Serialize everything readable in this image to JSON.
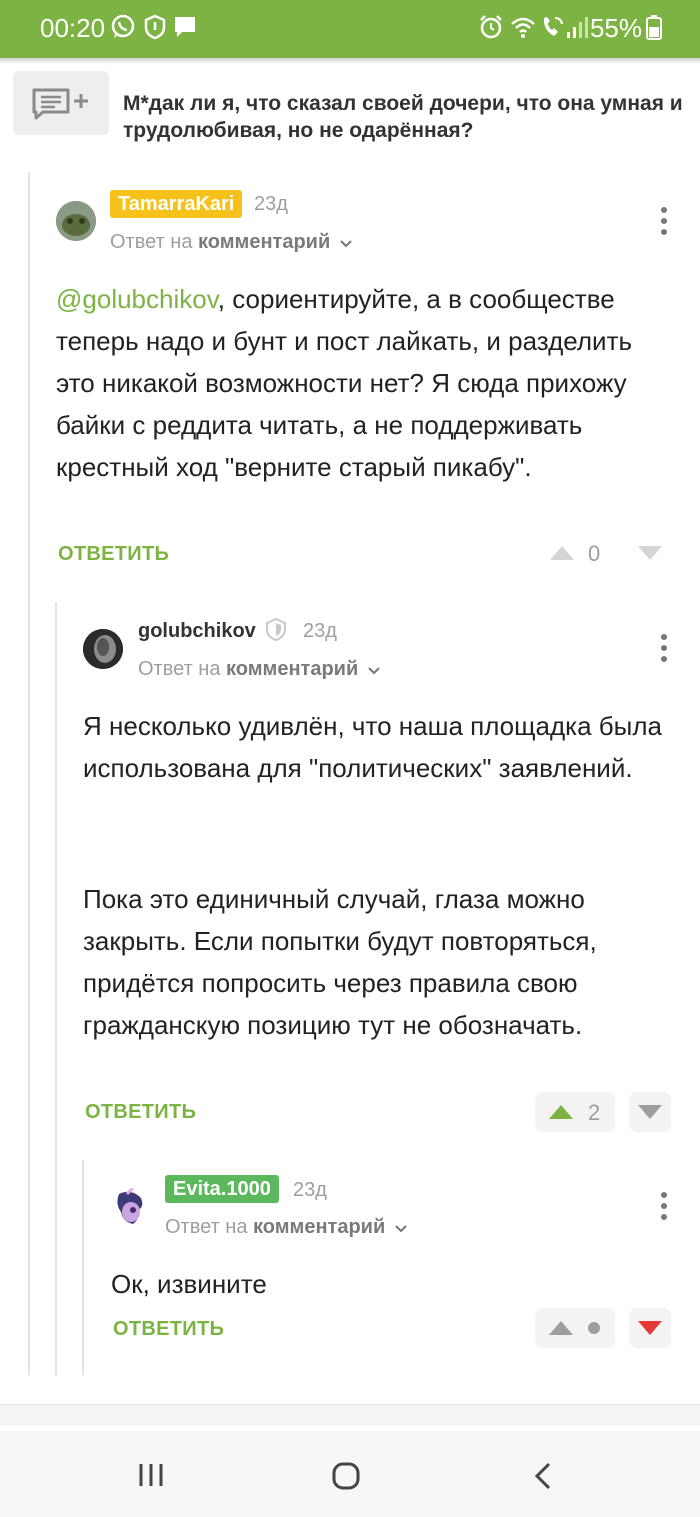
{
  "status_bar": {
    "time": "00:20",
    "battery": "55%",
    "left_icons": [
      "whatsapp-icon",
      "shield-icon",
      "message-icon"
    ],
    "right_icons": [
      "alarm-icon",
      "wifi-icon",
      "wifi-call-icon",
      "signal-icon",
      "battery-icon"
    ],
    "color": "#7cb342"
  },
  "post": {
    "icon": "comments-add-icon",
    "title": "М*дак ли я, что сказал своей дочери, что она умная и трудолюбивая, но не одарённая?"
  },
  "reply_to_prefix": "Ответ на",
  "reply_to_link": "комментарий",
  "comments": [
    {
      "author": "TamarraKari",
      "age": "23д",
      "mention": "@golubchikov",
      "text": ", сориентируйте, а в сообществе теперь надо и бунт и пост лайкать, и разделить это никакой возможности нет? Я сюда прихожу байки с реддита читать, а не поддерживать крестный ход \"верните старый пикабу\".",
      "reply_label": "ОТВЕТИТЬ",
      "votes": "0"
    },
    {
      "author": "golubchikov",
      "age": "23д",
      "paragraph1": "Я несколько удивлён, что наша площадка была использована для \"политических\" заявлений.",
      "paragraph2": "Пока это единичный случай, глаза можно закрыть. Если попытки будут повторяться, придётся попросить через правила свою гражданскую позицию тут не обозначать.",
      "reply_label": "ОТВЕТИТЬ",
      "votes": "2",
      "user_vote": "up"
    },
    {
      "author": "Evita.1000",
      "age": "23д",
      "text": "Ок, извините",
      "reply_label": "ОТВЕТИТЬ",
      "user_vote": "down"
    }
  ],
  "nav": {
    "buttons": [
      "recents-icon",
      "home-icon",
      "back-icon"
    ]
  },
  "colors": {
    "accent": "#7cb342",
    "badge_yellow": "#f6c21a",
    "badge_green": "#5cb85c",
    "downvote_red": "#e53935"
  }
}
